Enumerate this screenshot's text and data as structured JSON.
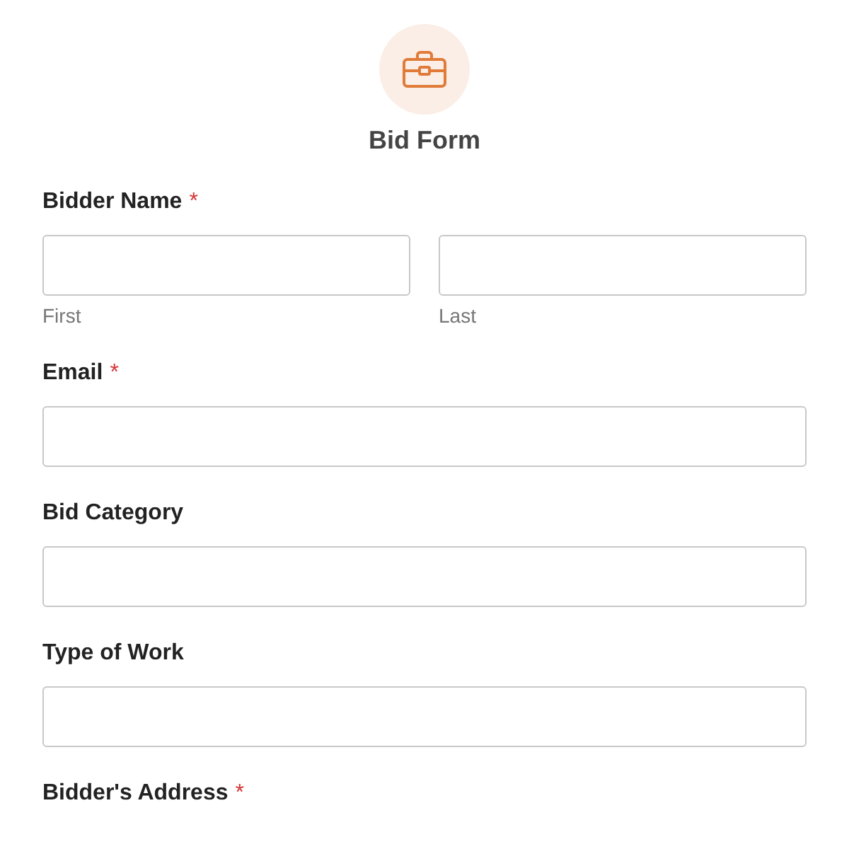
{
  "header": {
    "title": "Bid Form"
  },
  "required_marker": "*",
  "fields": [
    {
      "kind": "name",
      "label": "Bidder Name",
      "required": true,
      "sublabels": [
        "First",
        "Last"
      ]
    },
    {
      "kind": "text",
      "label": "Email",
      "required": true
    },
    {
      "kind": "text",
      "label": "Bid Category",
      "required": false
    },
    {
      "kind": "text",
      "label": "Type of Work",
      "required": false
    },
    {
      "kind": "heading",
      "label": "Bidder's Address",
      "required": true
    }
  ]
}
